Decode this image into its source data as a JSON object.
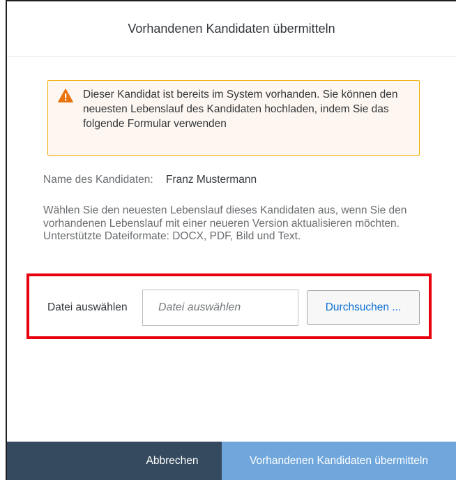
{
  "dialog": {
    "title": "Vorhandenen Kandidaten übermitteln"
  },
  "warning": {
    "icon": "warning-icon",
    "text": "Dieser Kandidat ist bereits im System vorhanden. Sie können den neuesten Lebenslauf des Kandidaten hochladen, indem Sie das folgende Formular verwenden",
    "color": "#f0ab00"
  },
  "candidate": {
    "name_label": "Name des Kandidaten:",
    "name_value": "Franz Mustermann"
  },
  "description": "Wählen Sie den neuesten Lebenslauf dieses Kandidaten aus, wenn Sie den vorhandenen Lebenslauf mit einer neueren Version aktualisieren möchten. Unterstützte Dateiformate: DOCX, PDF, Bild und Text.",
  "file": {
    "label": "Datei auswählen",
    "placeholder": "Datei auswählen",
    "browse_label": "Durchsuchen ..."
  },
  "footer": {
    "cancel_label": "Abbrechen",
    "submit_label": "Vorhandenen Kandidaten übermitteln"
  },
  "colors": {
    "footer_bg": "#354a5f",
    "submit_bg": "#6fa6db",
    "highlight": "#e8000e",
    "link": "#0a6ed1"
  }
}
